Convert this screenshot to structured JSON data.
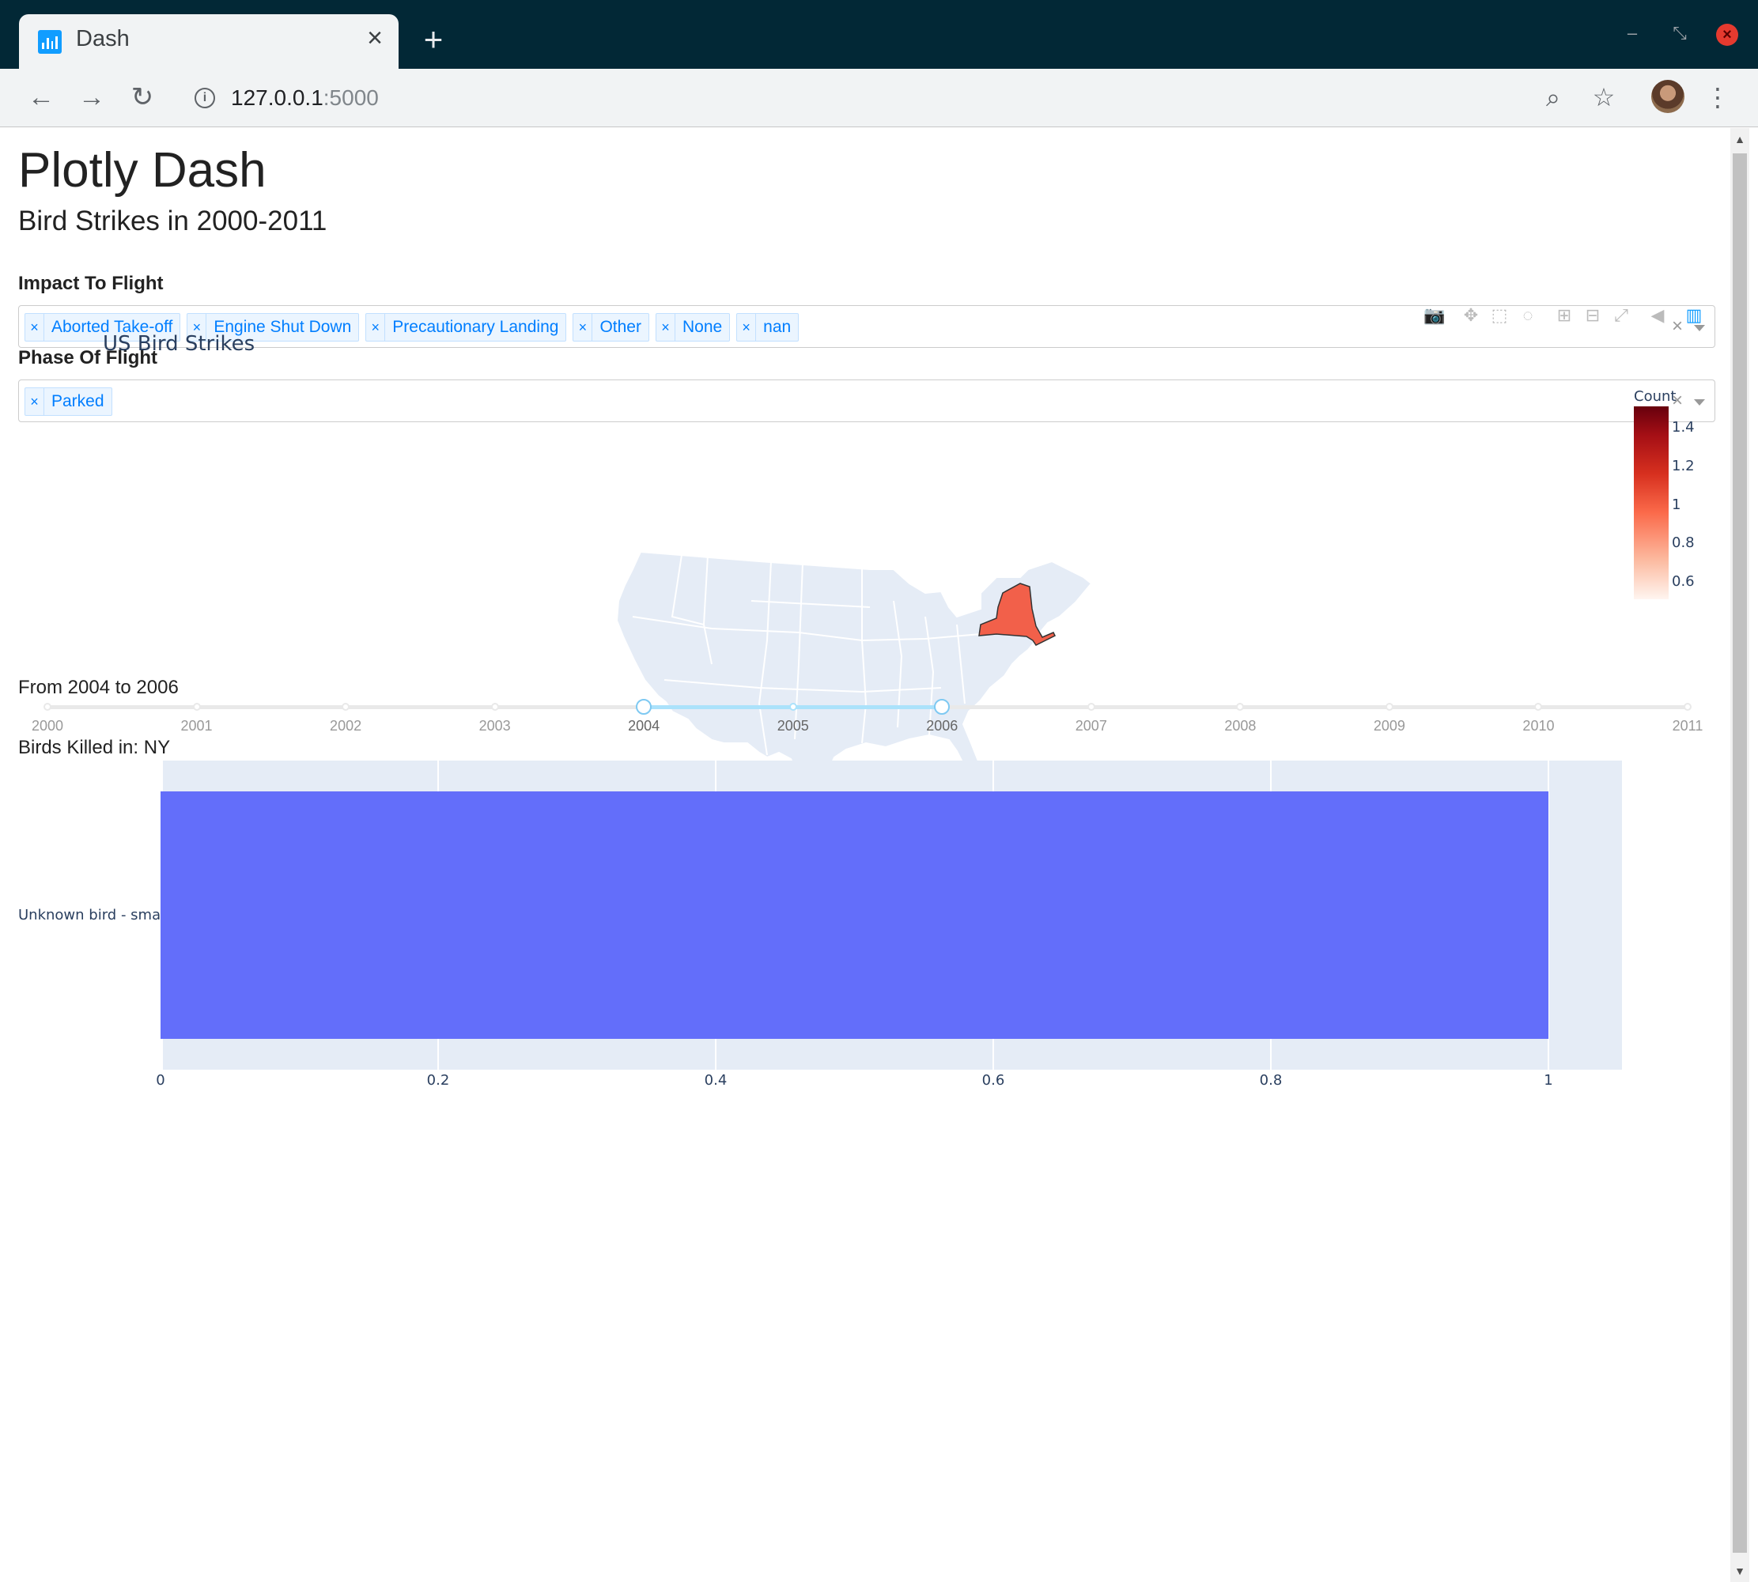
{
  "browser": {
    "tab_title": "Dash",
    "url_host": "127.0.0.1",
    "url_port": ":5000"
  },
  "page": {
    "title": "Plotly Dash",
    "subtitle": "Bird Strikes in 2000-2011"
  },
  "impact_filter": {
    "label": "Impact To Flight",
    "selected": [
      "Aborted Take-off",
      "Engine Shut Down",
      "Precautionary Landing",
      "Other",
      "None",
      "nan"
    ]
  },
  "phase_filter": {
    "label": "Phase Of Flight",
    "selected": [
      "Parked"
    ]
  },
  "modebar_icons": [
    "camera-icon",
    "pan-icon",
    "box-select-icon",
    "lasso-select-icon",
    "zoom-in-icon",
    "zoom-out-icon",
    "autoscale-icon",
    "hover-toggle-icon",
    "plotly-logo-icon"
  ],
  "map": {
    "title": "US Bird Strikes",
    "highlighted_state": "NY",
    "highlight_color": "#f2604a",
    "land_color": "#e5ecf6",
    "colorbar": {
      "title": "Count",
      "ticks": [
        "1.4",
        "1.2",
        "1",
        "0.8",
        "0.6"
      ]
    }
  },
  "year_slider": {
    "label": "From 2004 to 2006",
    "marks": [
      "2000",
      "2001",
      "2002",
      "2003",
      "2004",
      "2005",
      "2006",
      "2007",
      "2008",
      "2009",
      "2010",
      "2011"
    ],
    "range": [
      2004,
      2006
    ],
    "track_color": "#abe2fb"
  },
  "bar_chart": {
    "title": "Birds Killed in: NY"
  },
  "chart_data": [
    {
      "type": "bar",
      "orientation": "horizontal",
      "title": "Birds Killed in: NY",
      "categories": [
        "Unknown bird - small"
      ],
      "values": [
        1
      ],
      "x_ticks": [
        "0",
        "0.2",
        "0.4",
        "0.6",
        "0.8",
        "1"
      ],
      "xlim": [
        0,
        1.05
      ],
      "bar_color": "#636efa",
      "plot_bg": "#e5ecf6",
      "grid": true
    }
  ]
}
